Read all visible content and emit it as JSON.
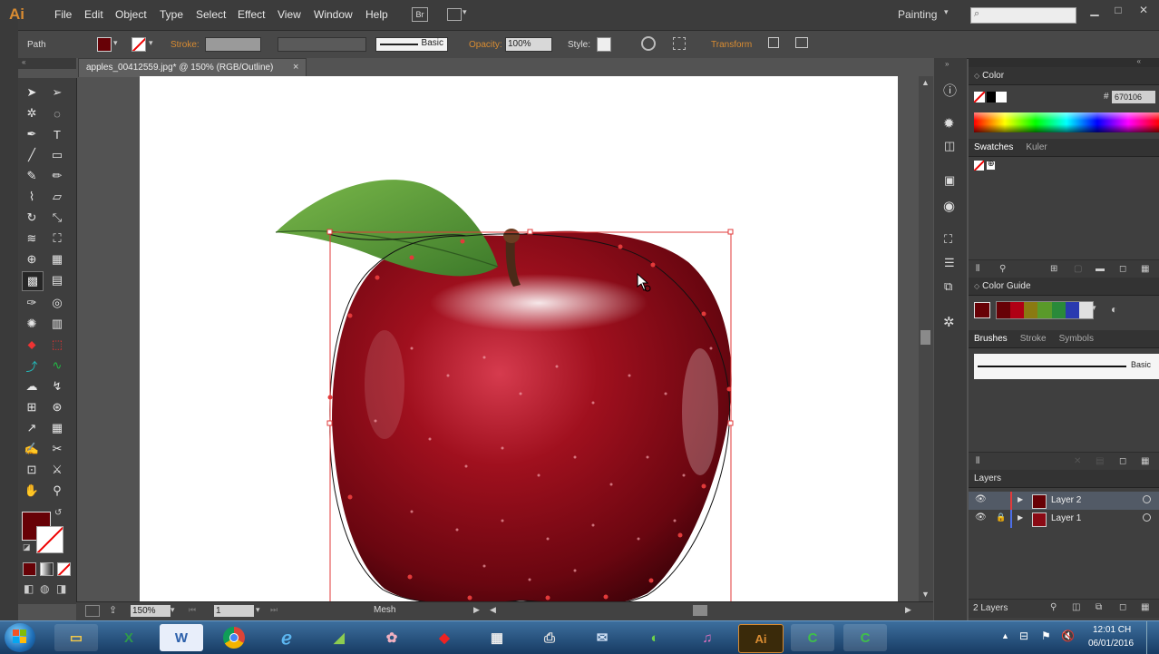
{
  "app": {
    "logo": "Ai",
    "workspace": "Painting"
  },
  "menu": [
    "File",
    "Edit",
    "Object",
    "Type",
    "Select",
    "Effect",
    "View",
    "Window",
    "Help"
  ],
  "menu_extra": {
    "bridge": "Br"
  },
  "control_bar": {
    "selection": "Path",
    "stroke_label": "Stroke:",
    "brush_label": "Basic",
    "opacity_label": "Opacity:",
    "opacity_value": "100%",
    "style_label": "Style:",
    "transform_label": "Transform",
    "fill_color": "#670106"
  },
  "document": {
    "tab_title": "apples_00412559.jpg* @ 150% (RGB/Outline)",
    "close": "×"
  },
  "statusbar": {
    "zoom": "150%",
    "artboard": "1",
    "tool_name": "Mesh"
  },
  "panels": {
    "color": {
      "title": "Color",
      "hash": "#",
      "hex": "670106"
    },
    "swatches": {
      "tabs": [
        "Swatches",
        "Kuler"
      ]
    },
    "color_guide": {
      "title": "Color Guide",
      "harmony": [
        "#670106",
        "#b00015",
        "#8a7a12",
        "#5a9a2a",
        "#2a8a3a",
        "#2a3ab0",
        "#e0e0e0"
      ]
    },
    "brushes": {
      "tabs": [
        "Brushes",
        "Stroke",
        "Symbols"
      ],
      "brush_name": "Basic"
    },
    "layers": {
      "title": "Layers",
      "items": [
        "Layer 2",
        "Layer 1"
      ],
      "count": "2 Layers"
    }
  },
  "taskbar": {
    "time": "12:01 CH",
    "date": "06/01/2016",
    "apps": [
      "Start",
      "Explorer",
      "Excel",
      "Word",
      "Chrome",
      "IE",
      "Tool",
      "Paint",
      "Adobe",
      "Calendar",
      "Scanner",
      "Mail",
      "Green",
      "Photoshop",
      "Illustrator",
      "Camtasia",
      "Camtasia2"
    ]
  }
}
